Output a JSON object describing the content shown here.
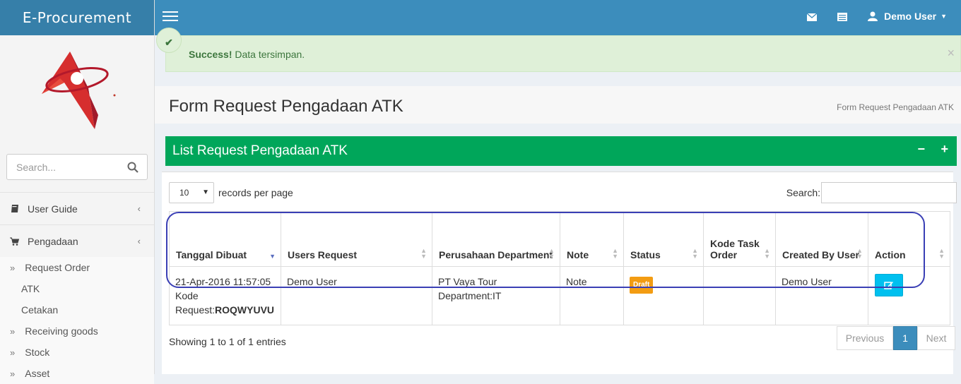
{
  "brand": {
    "title": "E-Procurement"
  },
  "sidebar": {
    "search_placeholder": "Search...",
    "menu": [
      {
        "label": "User Guide",
        "icon": "book-icon"
      },
      {
        "label": "Pengadaan",
        "icon": "cart-icon"
      }
    ],
    "submenu": [
      {
        "label": "Request Order"
      },
      {
        "label": "ATK"
      },
      {
        "label": "Cetakan"
      },
      {
        "label": "Receiving goods"
      },
      {
        "label": "Stock"
      },
      {
        "label": "Asset"
      }
    ]
  },
  "topbar": {
    "user_label": "Demo User",
    "icons": [
      "envelope-icon",
      "list-icon",
      "user-icon"
    ]
  },
  "alert": {
    "strong": "Success!",
    "text": " Data tersimpan."
  },
  "page": {
    "title": "Form Request Pengadaan ATK",
    "breadcrumb": "Form Request Pengadaan ATK"
  },
  "box": {
    "title": "List Request Pengadaan ATK"
  },
  "table_controls": {
    "length_value": "10",
    "length_label": "records per page",
    "search_label": "Search:"
  },
  "table": {
    "headers": [
      "Tanggal Dibuat",
      "Users Request",
      "Perusahaan Department",
      "Note",
      "Status",
      "Kode Task Order",
      "Created By User",
      "Action"
    ],
    "row": {
      "date": "21-Apr-2016 11:57:05",
      "kode_label": "Kode Request:",
      "kode_value": "ROQWYUVU",
      "user": "Demo User",
      "perusahaan": "PT Vaya Tour",
      "department": "Department:IT",
      "note": "Note",
      "status": "Draft",
      "kode_task": "",
      "created_by": "Demo User"
    }
  },
  "footer": {
    "info": "Showing 1 to 1 of 1 entries",
    "prev": "Previous",
    "current": "1",
    "next": "Next"
  },
  "colors": {
    "topbar": "#3c8dbc",
    "brand": "#367fa9",
    "box_header": "#00a65a",
    "badge": "#f39c12",
    "edit_button": "#00c0ef",
    "highlight": "#3a3fb5"
  }
}
